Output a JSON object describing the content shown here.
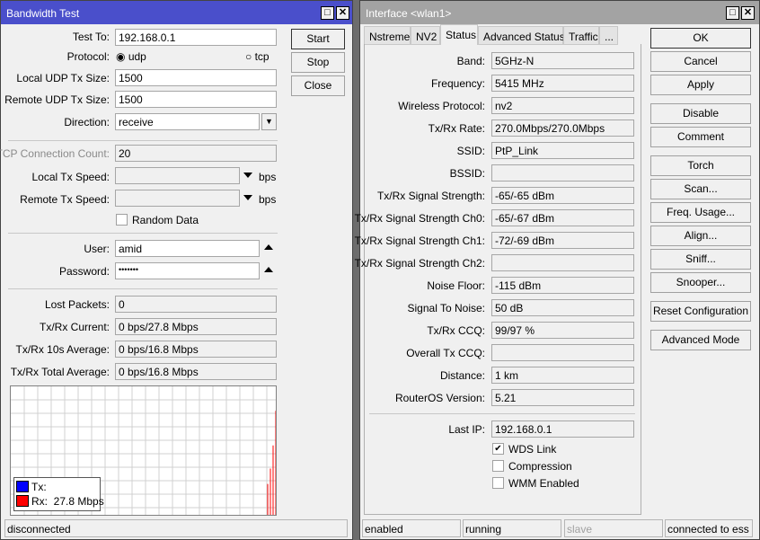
{
  "bw": {
    "title": "Bandwidth Test",
    "buttons": {
      "start": "Start",
      "stop": "Stop",
      "close": "Close"
    },
    "test_to_label": "Test To:",
    "test_to": "192.168.0.1",
    "protocol_label": "Protocol:",
    "protocol_udp": "udp",
    "protocol_tcp": "tcp",
    "protocol_selected": "udp",
    "local_udp_label": "Local UDP Tx Size:",
    "local_udp": "1500",
    "remote_udp_label": "Remote UDP Tx Size:",
    "remote_udp": "1500",
    "direction_label": "Direction:",
    "direction": "receive",
    "tcp_count_label": "TCP Connection Count:",
    "tcp_count": "20",
    "local_speed_label": "Local Tx Speed:",
    "remote_speed_label": "Remote Tx Speed:",
    "bps": "bps",
    "random_data": "Random Data",
    "user_label": "User:",
    "user": "amid",
    "password_label": "Password:",
    "password": "•••••••",
    "stats": [
      {
        "label": "Lost Packets:",
        "value": "0"
      },
      {
        "label": "Tx/Rx Current:",
        "value": "0 bps/27.8 Mbps"
      },
      {
        "label": "Tx/Rx 10s Average:",
        "value": "0 bps/16.8 Mbps"
      },
      {
        "label": "Tx/Rx Total Average:",
        "value": "0 bps/16.8 Mbps"
      }
    ],
    "legend": {
      "tx": "Tx:",
      "rx": "Rx:  27.8 Mbps"
    },
    "status": "disconnected"
  },
  "chart_data": {
    "type": "bar",
    "series": [
      {
        "name": "Tx",
        "color": "#0000ff",
        "values": []
      },
      {
        "name": "Rx",
        "color": "#ff0000",
        "values": [
          0.24,
          0.36,
          0.54,
          0.81
        ]
      }
    ],
    "ylabel": "fraction of graph height"
  },
  "iface": {
    "title": "Interface <wlan1>",
    "tabs": [
      "Nstreme",
      "NV2",
      "Status",
      "Advanced Status",
      "Traffic",
      "..."
    ],
    "active_tab": "Status",
    "fields": [
      {
        "label": "Band:",
        "value": "5GHz-N"
      },
      {
        "label": "Frequency:",
        "value": "5415 MHz"
      },
      {
        "label": "Wireless Protocol:",
        "value": "nv2"
      },
      {
        "label": "Tx/Rx Rate:",
        "value": "270.0Mbps/270.0Mbps"
      },
      {
        "label": "SSID:",
        "value": "PtP_Link"
      },
      {
        "label": "BSSID:",
        "value": ""
      },
      {
        "label": "Tx/Rx Signal Strength:",
        "value": "-65/-65 dBm"
      },
      {
        "label": "Tx/Rx Signal Strength Ch0:",
        "value": "-65/-67 dBm"
      },
      {
        "label": "Tx/Rx Signal Strength Ch1:",
        "value": "-72/-69 dBm"
      },
      {
        "label": "Tx/Rx Signal Strength Ch2:",
        "value": ""
      },
      {
        "label": "Noise Floor:",
        "value": "-115 dBm"
      },
      {
        "label": "Signal To Noise:",
        "value": "50 dB"
      },
      {
        "label": "Tx/Rx CCQ:",
        "value": "99/97 %"
      },
      {
        "label": "Overall Tx CCQ:",
        "value": ""
      },
      {
        "label": "Distance:",
        "value": "1 km"
      },
      {
        "label": "RouterOS Version:",
        "value": "5.21"
      }
    ],
    "last_ip_label": "Last IP:",
    "last_ip": "192.168.0.1",
    "checks": [
      {
        "label": "WDS Link",
        "checked": true
      },
      {
        "label": "Compression",
        "checked": false
      },
      {
        "label": "WMM Enabled",
        "checked": false
      }
    ],
    "buttons": [
      "OK",
      "Cancel",
      "Apply",
      "Disable",
      "Comment",
      "Torch",
      "Scan...",
      "Freq. Usage...",
      "Align...",
      "Sniff...",
      "Snooper...",
      "Reset Configuration",
      "Advanced Mode"
    ],
    "status": [
      "enabled",
      "running",
      "slave",
      "connected to ess"
    ]
  }
}
